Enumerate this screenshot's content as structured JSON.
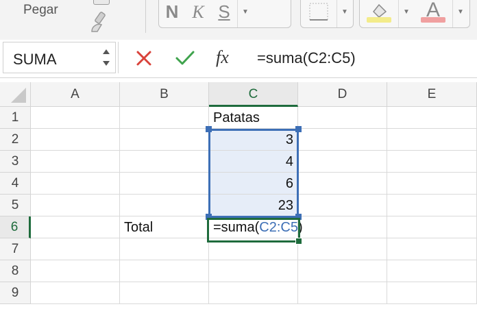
{
  "ribbon": {
    "paste_label": "Pegar",
    "bold_label": "N",
    "italic_label": "K",
    "underline_label": "S",
    "font_color_letter": "A",
    "fill_swatch_color": "#f3ec8a",
    "font_swatch_color": "#f0a0a0"
  },
  "formula_bar": {
    "name_box": "SUMA",
    "fx_label": "fx",
    "formula": "=suma(C2:C5)",
    "cancel_color": "#d9423a",
    "enter_color": "#3fa34d"
  },
  "grid": {
    "columns": [
      "A",
      "B",
      "C",
      "D",
      "E"
    ],
    "rows": [
      "1",
      "2",
      "3",
      "4",
      "5",
      "6",
      "7",
      "8",
      "9"
    ],
    "active_column": "C",
    "active_row": "6",
    "cells": {
      "C1": "Patatas",
      "C2": "3",
      "C3": "4",
      "C4": "6",
      "C5": "23",
      "B6": "Total"
    },
    "edit_cell": {
      "prefix": "=suma(",
      "ref": "C2:C5",
      "suffix": ")"
    },
    "range_color": "#3d6fb6",
    "active_color": "#1e6b3c"
  }
}
